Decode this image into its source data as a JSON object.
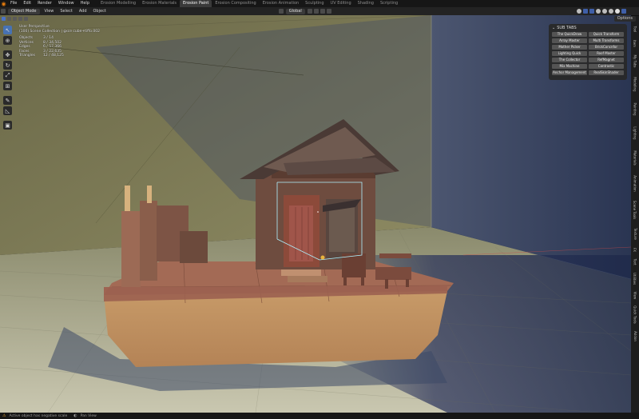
{
  "topbar": {
    "menus": [
      "File",
      "Edit",
      "Render",
      "Window",
      "Help"
    ],
    "workspaces": [
      "Erosion Modelling",
      "Erosion Materials",
      "Erosion Paint",
      "Erosion Compositing",
      "Erosion Animation",
      "Sculpting",
      "UV Editing",
      "Shading",
      "Scripting"
    ],
    "active_workspace": "Erosion Paint"
  },
  "header": {
    "mode": "Object Mode",
    "menus": [
      "View",
      "Select",
      "Add",
      "Object"
    ],
    "transform_orientation": "Global",
    "options_label": "Options"
  },
  "overlay": {
    "view_name": "User Perspective",
    "collection": "(100) Scene Collection | gxce cube+tiffo.002",
    "stats": [
      {
        "label": "Objects",
        "value": "3 / 14"
      },
      {
        "label": "Vertices",
        "value": "8 / 34,502"
      },
      {
        "label": "Edges",
        "value": "6 / 57,366"
      },
      {
        "label": "Faces",
        "value": "3 / 22,635"
      },
      {
        "label": "Triangles",
        "value": "12 / 48,125"
      }
    ]
  },
  "subtabs": {
    "title": "SUB TABS",
    "buttons": [
      "The QuickDraw",
      "Quick Transform",
      "Array Master",
      "Multi Transforms",
      "Mother Picker",
      "BrickConcnfor",
      "Lighting Quick",
      "Roof Master",
      "The Collector",
      "RefMagnet",
      "Mix Machine",
      "Contrastic",
      "Anchor Management",
      "RealSkinShader"
    ]
  },
  "sidebar_tabs": [
    "Tool",
    "Item",
    "My Tabs",
    "Modeling",
    "Painting",
    "Lighting",
    "Materials",
    "Animation",
    "Scene Tools",
    "Texture",
    "FX",
    "Text",
    "Utilities",
    "View",
    "Quick Tools",
    "Addon"
  ],
  "status": {
    "message": "Active object has negative scale",
    "view_label": "Pan View"
  },
  "colors": {
    "accent": "#4772b3",
    "active_tab": "#3a3a3a",
    "panel_bg": "#282828",
    "selection_outline": "#aef2ff"
  }
}
